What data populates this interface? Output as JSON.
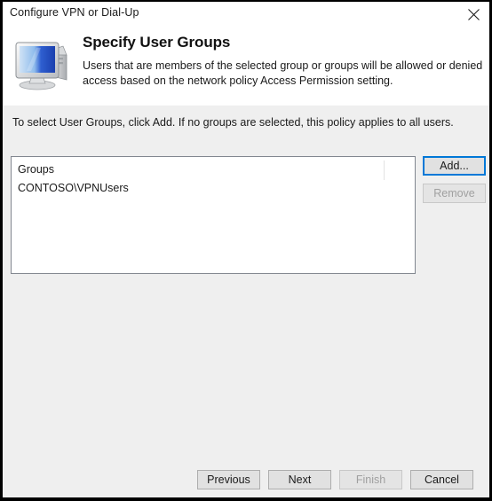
{
  "window": {
    "title": "Configure VPN or Dial-Up",
    "close_icon": "close-icon"
  },
  "header": {
    "icon": "computer-monitor-icon",
    "title": "Specify User Groups",
    "description": "Users that are members of the selected group or groups will be allowed or denied access based on the network policy Access Permission setting."
  },
  "body": {
    "instruction": "To select User Groups, click Add. If no groups are selected, this policy applies to all users."
  },
  "groups_list": {
    "column_header": "Groups",
    "rows": [
      "CONTOSO\\VPNUsers"
    ]
  },
  "side_buttons": {
    "add_label": "Add...",
    "remove_label": "Remove"
  },
  "footer_buttons": {
    "previous_label": "Previous",
    "next_label": "Next",
    "finish_label": "Finish",
    "cancel_label": "Cancel"
  },
  "colors": {
    "focus_accent": "#0078d7",
    "body_background": "#efefef",
    "button_face": "#e1e1e1",
    "disabled_text": "#a0a0a0",
    "border": "#828790"
  }
}
